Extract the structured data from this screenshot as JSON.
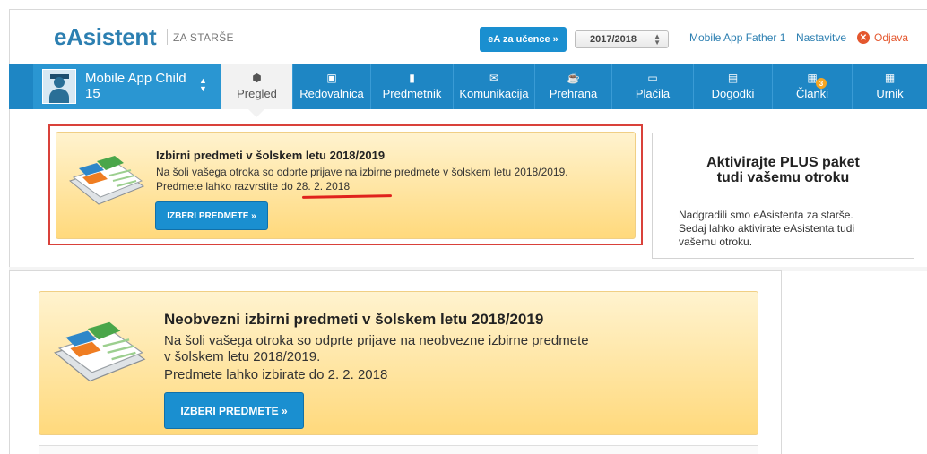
{
  "header": {
    "logo": "eAsistent",
    "logo_sub": "ZA STARŠE",
    "ea_button": "eA za učence »",
    "year": "2017/2018",
    "user": "Mobile App Father 1",
    "settings": "Nastavitve",
    "logout": "Odjava"
  },
  "child": {
    "name": "Mobile App Child",
    "number": "15"
  },
  "nav": {
    "active": "Pregled",
    "items": [
      "Redovalnica",
      "Predmetnik",
      "Komunikacija",
      "Prehrana",
      "Plačila",
      "Dogodki",
      "Članki",
      "Urnik"
    ],
    "badge": "3"
  },
  "notice1": {
    "title": "Izbirni predmeti v šolskem letu 2018/2019",
    "line1": "Na šoli vašega otroka so odprte prijave na izbirne predmete v šolskem letu 2018/2019.",
    "line2": "Predmete lahko razvrstite do 28. 2. 2018",
    "button": "IZBERI PREDMETE »"
  },
  "plus": {
    "title1": "Aktivirajte PLUS paket",
    "title2": "tudi vašemu otroku",
    "text1": "Nadgradili smo eAsistenta za starše.",
    "text2": "Sedaj lahko aktivirate eAsistenta tudi",
    "text3": "vašemu otroku."
  },
  "notice2": {
    "title": "Neobvezni izbirni predmeti v šolskem letu 2018/2019",
    "line1": "Na šoli vašega otroka so odprte prijave na neobvezne izbirne predmete",
    "line2": "v šolskem letu 2018/2019.",
    "line3": "Predmete lahko izbirate do 2. 2. 2018",
    "button": "IZBERI PREDMETE »"
  },
  "colors": {
    "accent": "#1e86c4",
    "button": "#1a8fd0",
    "highlight": "#d9413a",
    "notice": "#ffd97c"
  }
}
